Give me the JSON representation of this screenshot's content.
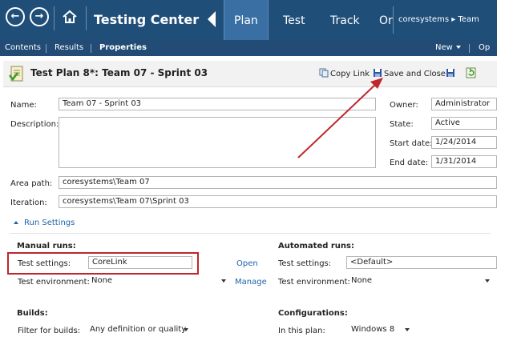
{
  "nav": {
    "app_title": "Testing Center",
    "tabs": [
      {
        "label": "Plan",
        "active": true
      },
      {
        "label": "Test",
        "active": false
      },
      {
        "label": "Track",
        "active": false
      },
      {
        "label": "Orga",
        "active": false
      }
    ],
    "breadcrumb": "coresystems ▸ Team"
  },
  "subnav": {
    "items": [
      "Contents",
      "Results",
      "Properties"
    ],
    "active": "Properties",
    "new_label": "New",
    "overflow_label": "Op"
  },
  "plan": {
    "title": "Test Plan 8*: Team 07 - Sprint 03",
    "copy_link_label": "Copy Link",
    "save_close_label": "Save and Close"
  },
  "form": {
    "name_label": "Name:",
    "name_value": "Team 07 - Sprint 03",
    "description_label": "Description:",
    "description_value": "",
    "area_label": "Area path:",
    "area_value": "coresystems\\Team 07",
    "iteration_label": "Iteration:",
    "iteration_value": "coresystems\\Team 07\\Sprint 03",
    "owner_label": "Owner:",
    "owner_value": "Administrator",
    "state_label": "State:",
    "state_value": "Active",
    "start_label": "Start date:",
    "start_value": "1/24/2014",
    "end_label": "End date:",
    "end_value": "1/31/2014"
  },
  "run_settings": {
    "toggle_label": "Run Settings",
    "manual": {
      "heading": "Manual runs:",
      "test_settings_label": "Test settings:",
      "test_settings_value": "CoreLink",
      "open_label": "Open",
      "env_label": "Test environment:",
      "env_value": "None",
      "manage_label": "Manage"
    },
    "automated": {
      "heading": "Automated runs:",
      "test_settings_label": "Test settings:",
      "test_settings_value": "<Default>",
      "env_label": "Test environment:",
      "env_value": "None"
    }
  },
  "builds": {
    "heading": "Builds:",
    "filter_label": "Filter for builds:",
    "filter_value": "Any definition or quality"
  },
  "configurations": {
    "heading": "Configurations:",
    "in_plan_label": "In this plan:",
    "in_plan_value": "Windows 8"
  },
  "colors": {
    "nav_bg": "#1f4e79",
    "active_tab": "#3a6fa3",
    "highlight": "#c0262c",
    "link": "#1f63a8"
  }
}
